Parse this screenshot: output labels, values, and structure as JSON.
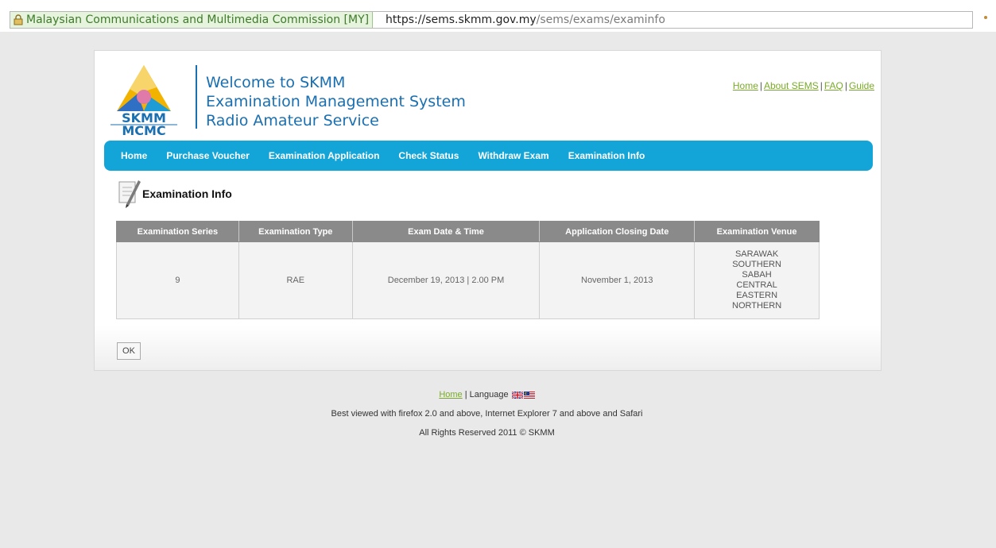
{
  "browser": {
    "identity_label": "Malaysian Communications and Multimedia Commission [MY]",
    "url_scheme": "https://",
    "url_host": "sems.skmm.gov.my",
    "url_path": "/sems/exams/examinfo"
  },
  "header": {
    "logo_text_top": "SKMM",
    "logo_text_bottom": "MCMC",
    "welcome_line1": "Welcome to SKMM",
    "welcome_line2": "Examination Management System",
    "welcome_line3": "Radio Amateur Service"
  },
  "top_links": [
    {
      "label": "Home"
    },
    {
      "label": "About SEMS"
    },
    {
      "label": "FAQ"
    },
    {
      "label": "Guide"
    }
  ],
  "top_links_separator": "|",
  "nav": {
    "items": [
      {
        "label": "Home"
      },
      {
        "label": "Purchase Voucher"
      },
      {
        "label": "Examination Application"
      },
      {
        "label": "Check Status"
      },
      {
        "label": "Withdraw Exam"
      },
      {
        "label": "Examination Info"
      }
    ]
  },
  "section": {
    "title": "Examination Info"
  },
  "table": {
    "headers": [
      "Examination Series",
      "Examination Type",
      "Exam Date & Time",
      "Application Closing Date",
      "Examination Venue"
    ],
    "rows": [
      {
        "series": "9",
        "type": "RAE",
        "date_time": "December 19, 2013 | 2.00 PM",
        "closing_date": "November 1, 2013",
        "venues": [
          "SARAWAK",
          "SOUTHERN",
          "SABAH",
          "CENTRAL",
          "EASTERN",
          "NORTHERN"
        ]
      }
    ]
  },
  "ok_label": "OK",
  "footer": {
    "home_label": "Home",
    "separator": "|",
    "language_label": "Language",
    "browser_note": "Best viewed with firefox 2.0 and above, Internet Explorer 7 and above and Safari",
    "copyright": "All Rights Reserved 2011 © SKMM"
  },
  "colors": {
    "nav_bg": "#14a5d8",
    "brand_blue": "#1a6fb1",
    "link_green": "#7aab2a",
    "table_header_bg": "#8a8a8a"
  },
  "icons": [
    "lock-icon",
    "skmm-logo",
    "document-pen-icon",
    "uk-flag-icon",
    "malaysia-flag-icon"
  ]
}
